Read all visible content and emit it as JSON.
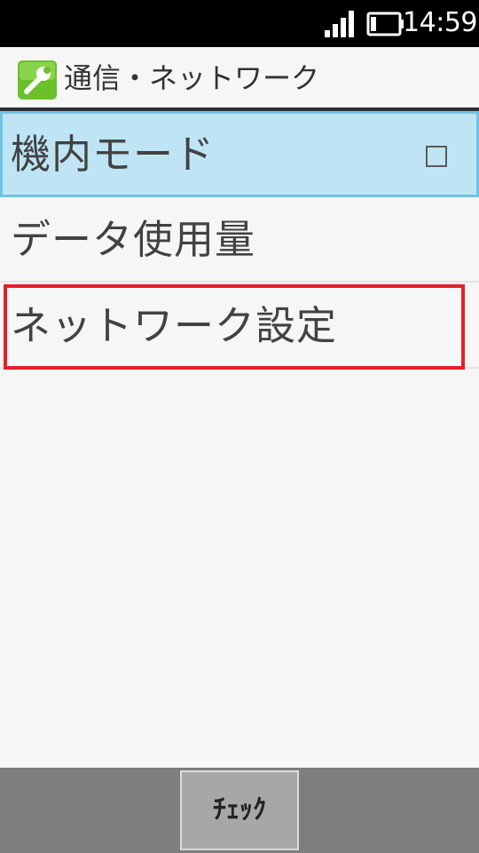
{
  "status_bar": {
    "time": "14:59",
    "signal_icon": "signal-strength-icon",
    "battery_icon": "battery-icon"
  },
  "header": {
    "icon": "wrench-icon",
    "title": "通信・ネットワーク"
  },
  "menu": {
    "items": [
      {
        "label": "機内モード",
        "checked": false
      },
      {
        "label": "データ使用量"
      },
      {
        "label": "ネットワーク設定"
      }
    ]
  },
  "softkeys": {
    "center_label": "ﾁｪｯｸ"
  },
  "colors": {
    "selected_bg": "#bfe5f5",
    "selected_border": "#6fc3e6",
    "annotation_red": "#e4202a",
    "icon_green": "#6cc12b"
  }
}
